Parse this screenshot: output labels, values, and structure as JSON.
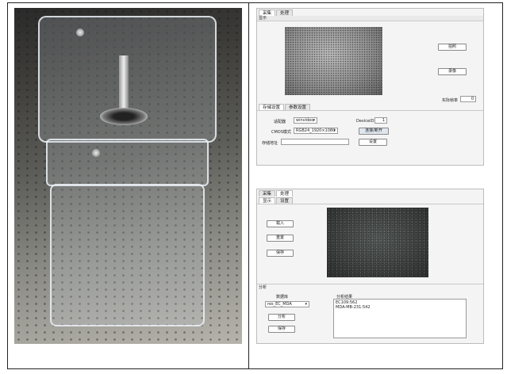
{
  "top_panel": {
    "tabs": [
      "采集",
      "处理"
    ],
    "subbar": "显示",
    "buttons": {
      "capture": "拍照",
      "record": "录像"
    },
    "frame_rate_label": "实际帧率",
    "frame_rate_value": "0",
    "settings_tabs": [
      "存储设置",
      "参数设置"
    ],
    "adapter_label": "适配器",
    "adapter_value": "winvideo",
    "device_label": "DeviceID",
    "device_value": "1",
    "cmos_label": "CMOS模式",
    "cmos_value": "RGB24_1920×1080",
    "connect_button": "连接/断开",
    "storage_label": "存储地址",
    "storage_value": "",
    "settings_button": "设置"
  },
  "bottom_panel": {
    "tabs": [
      "采集",
      "处理"
    ],
    "subtabs": [
      "显示",
      "设置"
    ],
    "buttons": {
      "load": "载入",
      "reset": "重置",
      "save": "保存"
    },
    "analysis_section": "分析",
    "database_label": "数据库",
    "database_value": "res_EC_MDA",
    "analyze_button": "分析",
    "save_button": "保存",
    "results_label": "分析结果",
    "results": [
      "EC109:562",
      "MDA-MB-231:542"
    ]
  }
}
